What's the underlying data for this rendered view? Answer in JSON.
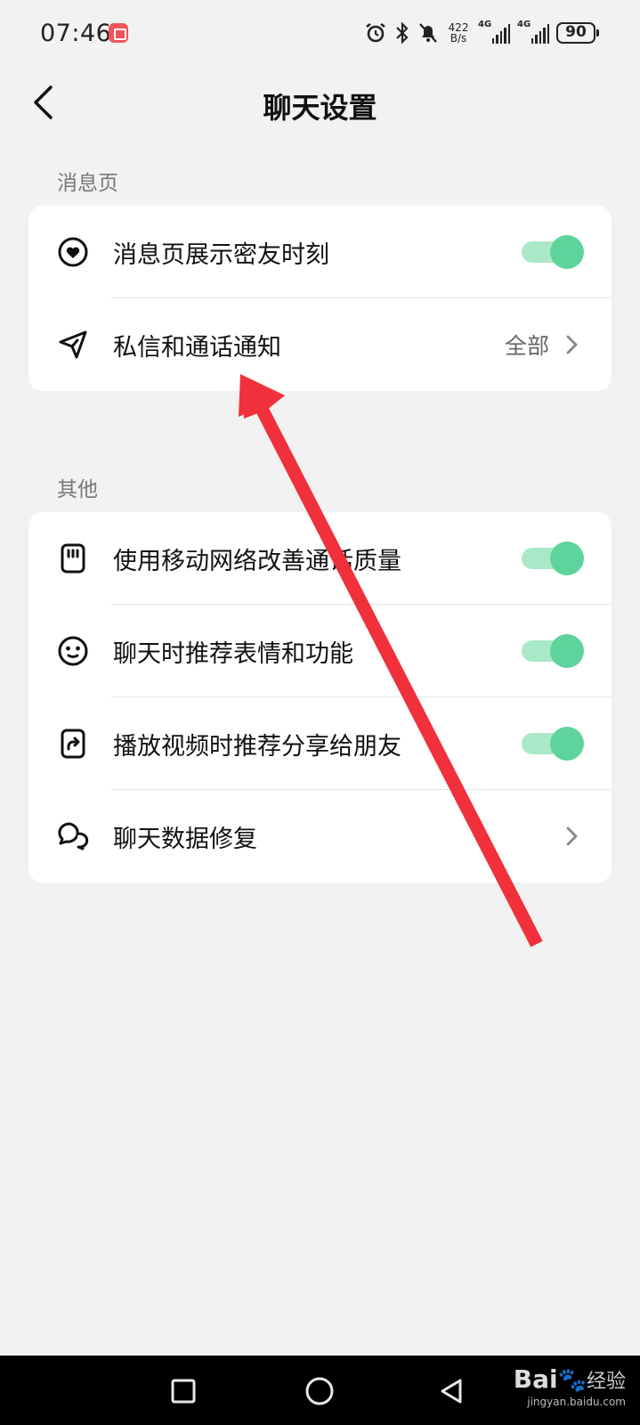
{
  "status_bar": {
    "time": "07:46",
    "net_speed_value": "422",
    "net_speed_unit": "B/s",
    "signal1_label": "4G",
    "signal2_label": "4G",
    "battery": "90"
  },
  "header": {
    "title": "聊天设置"
  },
  "sections": [
    {
      "label": "消息页",
      "rows": [
        {
          "label": "消息页展示密友时刻",
          "control": "toggle",
          "on": true
        },
        {
          "label": "私信和通话通知",
          "control": "link",
          "value": "全部"
        }
      ]
    },
    {
      "label": "其他",
      "rows": [
        {
          "label": "使用移动网络改善通话质量",
          "control": "toggle",
          "on": true
        },
        {
          "label": "聊天时推荐表情和功能",
          "control": "toggle",
          "on": true
        },
        {
          "label": "播放视频时推荐分享给朋友",
          "control": "toggle",
          "on": true
        },
        {
          "label": "聊天数据修复",
          "control": "link"
        }
      ]
    }
  ],
  "watermark": {
    "brand": "Bai",
    "brand2": "经验",
    "url": "jingyan.baidu.com"
  },
  "colors": {
    "toggle_on": "#5fd49a",
    "annotation_arrow": "#f0303a"
  }
}
